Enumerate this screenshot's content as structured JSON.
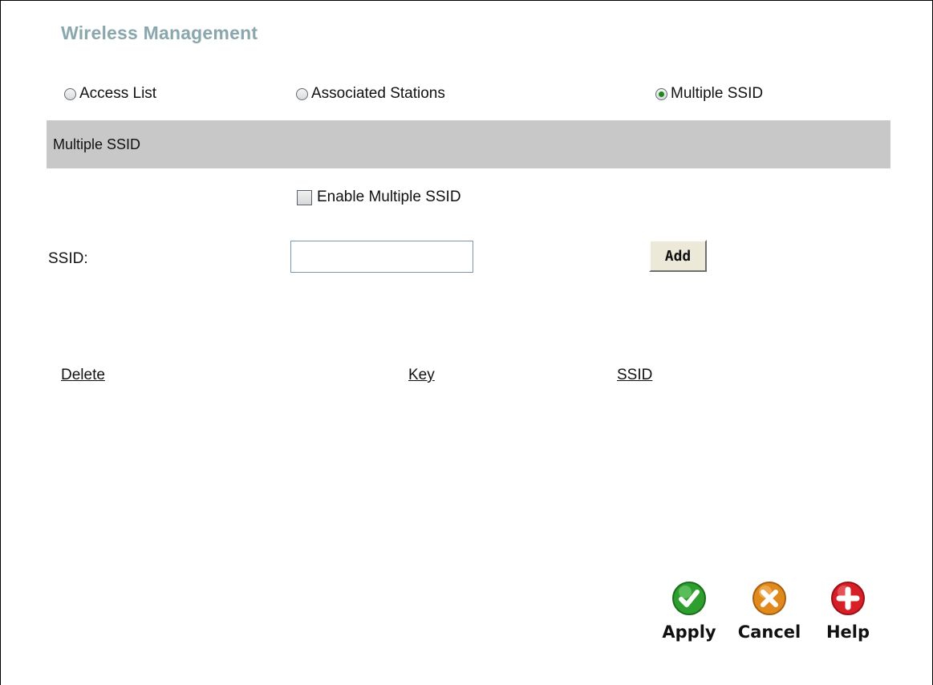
{
  "page": {
    "title": "Wireless Management"
  },
  "modes": [
    {
      "label": "Access List",
      "selected": false
    },
    {
      "label": "Associated Stations",
      "selected": false
    },
    {
      "label": "Multiple SSID",
      "selected": true
    }
  ],
  "section": {
    "title": "Multiple SSID"
  },
  "enable": {
    "label": "Enable Multiple SSID",
    "checked": false
  },
  "ssid": {
    "label": "SSID:",
    "value": "",
    "add_label": "Add"
  },
  "table": {
    "columns": [
      "Delete",
      "Key",
      "SSID"
    ]
  },
  "actions": [
    {
      "label": "Apply",
      "icon": "check-icon",
      "color": "#2e9e2e"
    },
    {
      "label": "Cancel",
      "icon": "x-icon",
      "color": "#e08a1e"
    },
    {
      "label": "Help",
      "icon": "plus-icon",
      "color": "#d61f26"
    }
  ]
}
